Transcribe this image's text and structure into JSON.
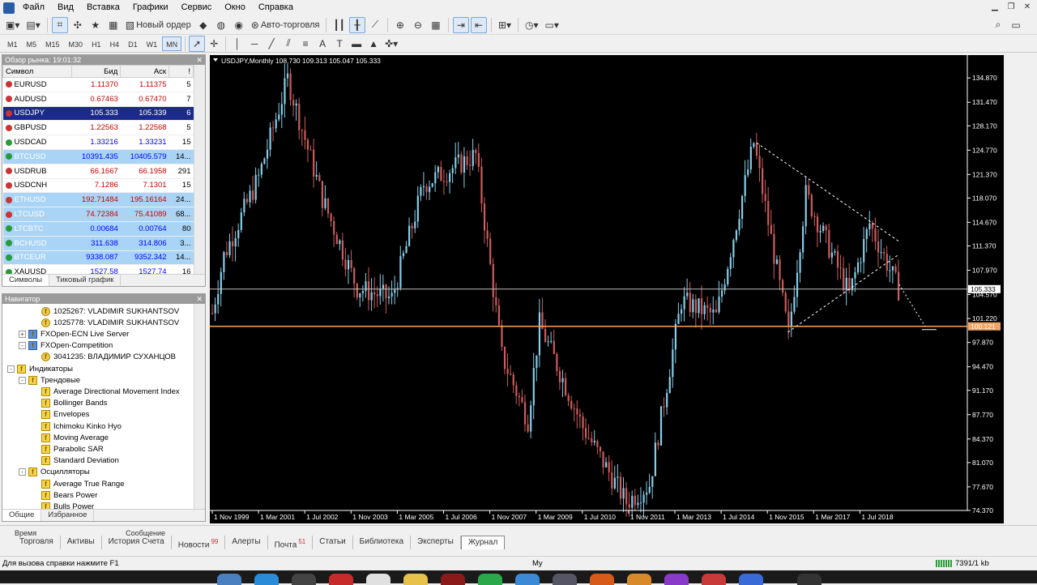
{
  "menu": [
    "Файл",
    "Вид",
    "Вставка",
    "Графики",
    "Сервис",
    "Окно",
    "Справка"
  ],
  "toolbar": {
    "new_order": "Новый ордер",
    "auto_trading": "Авто-торговля"
  },
  "timeframes": [
    "M1",
    "M5",
    "M15",
    "M30",
    "H1",
    "H4",
    "D1",
    "W1",
    "MN"
  ],
  "active_timeframe": "MN",
  "market_watch": {
    "title": "Обзор рынка: 19:01:32",
    "columns": [
      "Символ",
      "Бид",
      "Аск",
      "!"
    ],
    "rows": [
      {
        "symbol": "EURUSD",
        "bid": "1.11370",
        "ask": "1.11375",
        "spread": "5",
        "type": "down"
      },
      {
        "symbol": "AUDUSD",
        "bid": "0.67463",
        "ask": "0.67470",
        "spread": "7",
        "type": "down"
      },
      {
        "symbol": "USDJPY",
        "bid": "105.333",
        "ask": "105.339",
        "spread": "6",
        "type": "down",
        "selected": true
      },
      {
        "symbol": "GBPUSD",
        "bid": "1.22563",
        "ask": "1.22568",
        "spread": "5",
        "type": "down"
      },
      {
        "symbol": "USDCAD",
        "bid": "1.33216",
        "ask": "1.33231",
        "spread": "15",
        "type": "up"
      },
      {
        "symbol": "BTCUSD",
        "bid": "10391.435",
        "ask": "10405.579",
        "spread": "14...",
        "type": "up",
        "crypto": true
      },
      {
        "symbol": "USDRUB",
        "bid": "66.1667",
        "ask": "66.1958",
        "spread": "291",
        "type": "down"
      },
      {
        "symbol": "USDCNH",
        "bid": "7.1286",
        "ask": "7.1301",
        "spread": "15",
        "type": "down"
      },
      {
        "symbol": "ETHUSD",
        "bid": "192.71484",
        "ask": "195.16164",
        "spread": "24...",
        "type": "down",
        "crypto": true
      },
      {
        "symbol": "LTCUSD",
        "bid": "74.72384",
        "ask": "75.41089",
        "spread": "68...",
        "type": "down",
        "crypto": true
      },
      {
        "symbol": "LTCBTC",
        "bid": "0.00684",
        "ask": "0.00764",
        "spread": "80",
        "type": "up",
        "crypto": true
      },
      {
        "symbol": "BCHUSD",
        "bid": "311.638",
        "ask": "314.806",
        "spread": "3...",
        "type": "up",
        "crypto": true
      },
      {
        "symbol": "BTCEUR",
        "bid": "9338.087",
        "ask": "9352.342",
        "spread": "14...",
        "type": "up",
        "crypto": true
      },
      {
        "symbol": "XAUUSD",
        "bid": "1527.58",
        "ask": "1527.74",
        "spread": "16",
        "type": "up"
      }
    ],
    "tabs": [
      "Символы",
      "Тиковый график"
    ]
  },
  "navigator": {
    "title": "Навигатор",
    "items": [
      {
        "label": "1025267: VLADIMIR SUKHANTSOV",
        "icon": "account",
        "indent": 3
      },
      {
        "label": "1025778: VLADIMIR SUKHANTSOV",
        "icon": "account",
        "indent": 3
      },
      {
        "label": "FXOpen-ECN Live Server",
        "icon": "server",
        "indent": 1,
        "expander": "+"
      },
      {
        "label": "FXOpen-Competition",
        "icon": "server",
        "indent": 1,
        "expander": "-"
      },
      {
        "label": "3041235: ВЛАДИМИР СУХАНЦОВ",
        "icon": "account",
        "indent": 3
      },
      {
        "label": "Индикаторы",
        "icon": "folder",
        "indent": 0,
        "expander": "-"
      },
      {
        "label": "Трендовые",
        "icon": "folder",
        "indent": 1,
        "expander": "-"
      },
      {
        "label": "Average Directional Movement Index",
        "icon": "indicator",
        "indent": 3
      },
      {
        "label": "Bollinger Bands",
        "icon": "indicator",
        "indent": 3
      },
      {
        "label": "Envelopes",
        "icon": "indicator",
        "indent": 3
      },
      {
        "label": "Ichimoku Kinko Hyo",
        "icon": "indicator",
        "indent": 3
      },
      {
        "label": "Moving Average",
        "icon": "indicator",
        "indent": 3
      },
      {
        "label": "Parabolic SAR",
        "icon": "indicator",
        "indent": 3
      },
      {
        "label": "Standard Deviation",
        "icon": "indicator",
        "indent": 3
      },
      {
        "label": "Осцилляторы",
        "icon": "folder",
        "indent": 1,
        "expander": "-"
      },
      {
        "label": "Average True Range",
        "icon": "indicator",
        "indent": 3
      },
      {
        "label": "Bears Power",
        "icon": "indicator",
        "indent": 3
      },
      {
        "label": "Bulls Power",
        "icon": "indicator",
        "indent": 3
      }
    ],
    "tabs": [
      "Общие",
      "Избранное"
    ]
  },
  "chart": {
    "header": "USDJPY,Monthly  108.730 109.313 105.047 105.333",
    "current_price_label": "105.333",
    "level_label": "100.121"
  },
  "chart_data": {
    "type": "candlestick",
    "symbol": "USDJPY",
    "timeframe": "Monthly",
    "x_labels": [
      "1 Nov 1999",
      "1 Mar 2001",
      "1 Jul 2002",
      "1 Nov 2003",
      "1 Mar 2005",
      "1 Jul 2006",
      "1 Nov 2007",
      "1 Mar 2009",
      "1 Jul 2010",
      "1 Nov 2011",
      "1 Mar 2013",
      "1 Jul 2014",
      "1 Nov 2015",
      "1 Mar 2017",
      "1 Jul 2018"
    ],
    "y_ticks": [
      "134.870",
      "131.470",
      "128.170",
      "124.770",
      "121.370",
      "118.070",
      "114.670",
      "111.370",
      "107.970",
      "104.570",
      "101.220",
      "97.870",
      "94.470",
      "91.170",
      "87.770",
      "84.370",
      "81.070",
      "77.670",
      "74.370"
    ],
    "ylim": [
      74.37,
      135.8
    ],
    "current_price": 105.333,
    "horizontal_level": 100.121,
    "key_prices": [
      {
        "date": "1999-11",
        "price": 102.0
      },
      {
        "date": "2000-03",
        "price": 110.0
      },
      {
        "date": "2001-03",
        "price": 121.0
      },
      {
        "date": "2002-01",
        "price": 134.7
      },
      {
        "date": "2003-01",
        "price": 118.0
      },
      {
        "date": "2004-01",
        "price": 105.5
      },
      {
        "date": "2005-01",
        "price": 104.0
      },
      {
        "date": "2005-12",
        "price": 120.0
      },
      {
        "date": "2007-06",
        "price": 124.1
      },
      {
        "date": "2008-03",
        "price": 96.0
      },
      {
        "date": "2008-12",
        "price": 87.0
      },
      {
        "date": "2009-04",
        "price": 100.5
      },
      {
        "date": "2010-07",
        "price": 86.0
      },
      {
        "date": "2011-10",
        "price": 75.5
      },
      {
        "date": "2012-06",
        "price": 78.0
      },
      {
        "date": "2013-05",
        "price": 103.7
      },
      {
        "date": "2014-05",
        "price": 101.5
      },
      {
        "date": "2015-06",
        "price": 125.8
      },
      {
        "date": "2016-06",
        "price": 99.0
      },
      {
        "date": "2016-12",
        "price": 118.6
      },
      {
        "date": "2018-03",
        "price": 104.6
      },
      {
        "date": "2018-10",
        "price": 114.5
      },
      {
        "date": "2019-08",
        "price": 105.3
      }
    ],
    "trendline_prices": [
      {
        "from": [
          2015.5,
          125.8
        ],
        "to": [
          2019.6,
          112.0
        ]
      },
      {
        "from": [
          2016.4,
          99.3
        ],
        "to": [
          2019.6,
          110.2
        ]
      }
    ]
  },
  "bottom": {
    "columns": [
      "Время",
      "Сообщение"
    ],
    "tabs": [
      {
        "label": "Торговля"
      },
      {
        "label": "Активы"
      },
      {
        "label": "История Счета"
      },
      {
        "label": "Новости",
        "badge": "99"
      },
      {
        "label": "Алерты"
      },
      {
        "label": "Почта",
        "badge": "51"
      },
      {
        "label": "Статьи"
      },
      {
        "label": "Библиотека"
      },
      {
        "label": "Эксперты"
      },
      {
        "label": "Журнал",
        "active": true
      }
    ]
  },
  "status": {
    "help": "Для вызова справки нажмите F1",
    "profile": "My",
    "traffic": "7391/1 kb"
  },
  "colors": {
    "bull": "#87ceeb",
    "bear": "#cd5c5c",
    "level": "#f4a460",
    "current": "#c0c0c0"
  }
}
